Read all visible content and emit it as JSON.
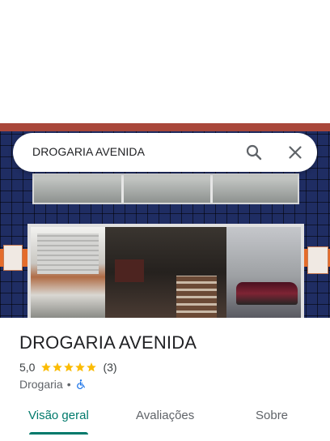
{
  "search": {
    "query": "DROGARIA AVENIDA"
  },
  "place": {
    "name": "DROGARIA AVENIDA",
    "rating": "5,0",
    "stars": 5,
    "review_count": "(3)",
    "category": "Drogaria",
    "separator": "•",
    "accessibility_icon": "wheelchair-icon"
  },
  "tabs": [
    {
      "label": "Visão geral",
      "active": true
    },
    {
      "label": "Avaliações",
      "active": false
    },
    {
      "label": "Sobre",
      "active": false
    }
  ],
  "colors": {
    "accent": "#00796b",
    "star": "#fbbc04",
    "accessibility": "#1a73e8"
  }
}
